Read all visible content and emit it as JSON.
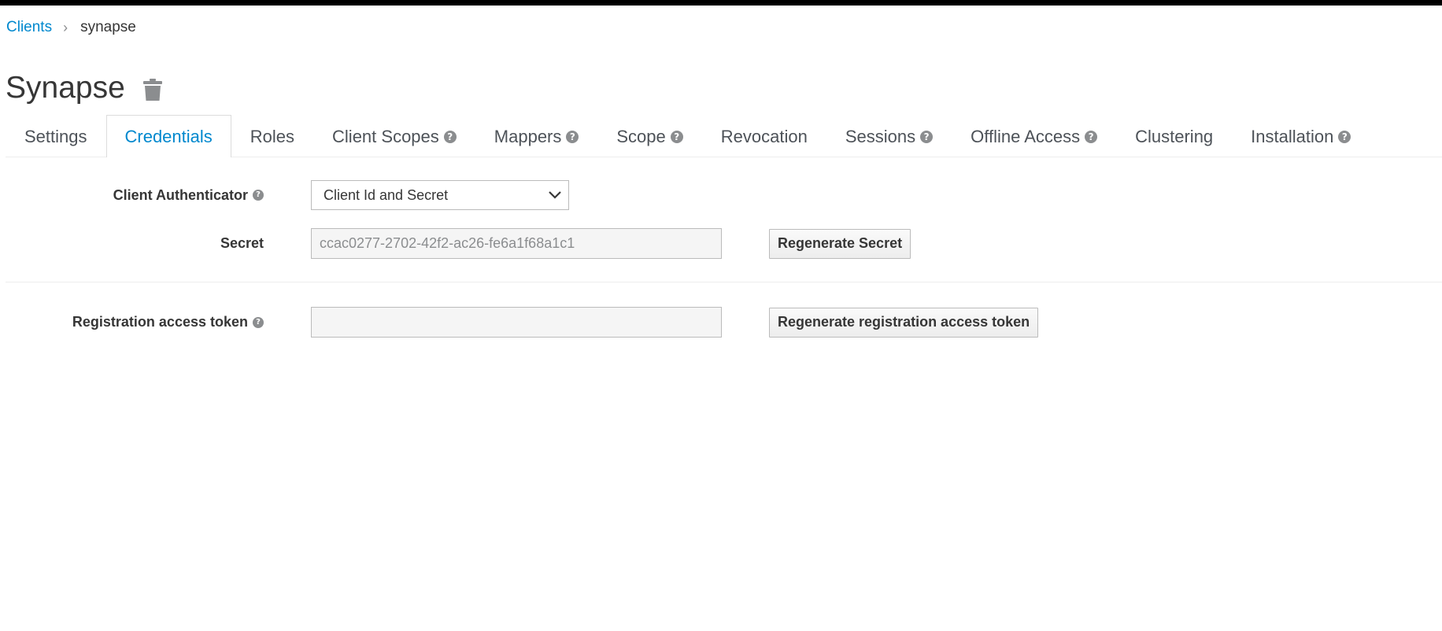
{
  "breadcrumb": {
    "parent": "Clients",
    "separator": "›",
    "current": "synapse"
  },
  "page": {
    "title": "Synapse",
    "delete_icon": "trash-icon"
  },
  "tabs": [
    {
      "label": "Settings",
      "help": false,
      "active": false
    },
    {
      "label": "Credentials",
      "help": false,
      "active": true
    },
    {
      "label": "Roles",
      "help": false,
      "active": false
    },
    {
      "label": "Client Scopes",
      "help": true,
      "active": false
    },
    {
      "label": "Mappers",
      "help": true,
      "active": false
    },
    {
      "label": "Scope",
      "help": true,
      "active": false
    },
    {
      "label": "Revocation",
      "help": false,
      "active": false
    },
    {
      "label": "Sessions",
      "help": true,
      "active": false
    },
    {
      "label": "Offline Access",
      "help": true,
      "active": false
    },
    {
      "label": "Clustering",
      "help": false,
      "active": false
    },
    {
      "label": "Installation",
      "help": true,
      "active": false
    }
  ],
  "form": {
    "authenticator": {
      "label": "Client Authenticator",
      "value": "Client Id and Secret"
    },
    "secret": {
      "label": "Secret",
      "value": "ccac0277-2702-42f2-ac26-fe6a1f68a1c1",
      "button": "Regenerate Secret"
    },
    "registration_token": {
      "label": "Registration access token",
      "value": "",
      "button": "Regenerate registration access token"
    }
  },
  "colors": {
    "accent": "#0088ce",
    "text": "#363636",
    "help_icon": "#8b8d8f",
    "topbar": "#000000"
  }
}
